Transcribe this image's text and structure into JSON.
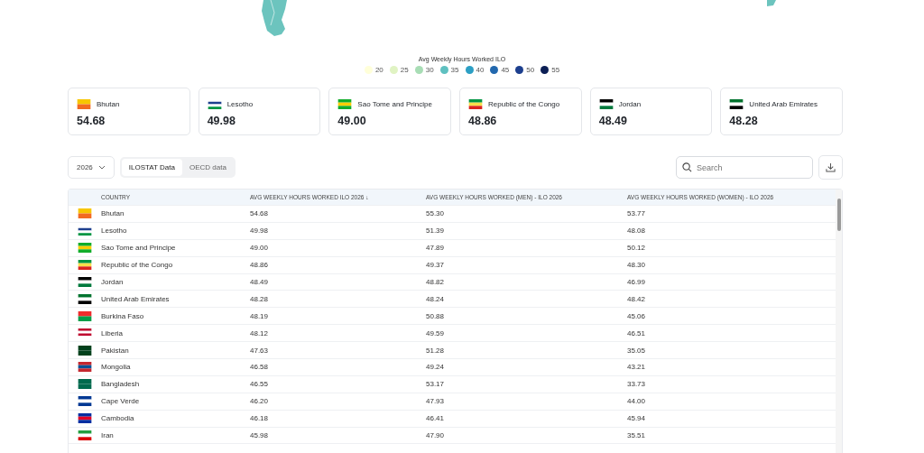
{
  "legend": {
    "title": "Avg Weekly Hours Worked ILO",
    "items": [
      {
        "label": "20",
        "color": "#ffffd9"
      },
      {
        "label": "25",
        "color": "#e0f3c3"
      },
      {
        "label": "30",
        "color": "#a8ddb5"
      },
      {
        "label": "35",
        "color": "#5fc0c0"
      },
      {
        "label": "40",
        "color": "#2c9fc4"
      },
      {
        "label": "45",
        "color": "#2268ae"
      },
      {
        "label": "50",
        "color": "#1d3f8e"
      },
      {
        "label": "55",
        "color": "#0c1f55"
      }
    ]
  },
  "cards": [
    {
      "country": "Bhutan",
      "value": "54.68"
    },
    {
      "country": "Lesotho",
      "value": "49.98"
    },
    {
      "country": "Sao Tome and Principe",
      "value": "49.00"
    },
    {
      "country": "Republic of the Congo",
      "value": "48.86"
    },
    {
      "country": "Jordan",
      "value": "48.49"
    },
    {
      "country": "United Arab Emirates",
      "value": "48.28"
    }
  ],
  "year_select": {
    "value": "2026"
  },
  "source_tabs": [
    {
      "label": "ILOSTAT Data",
      "selected": true
    },
    {
      "label": "OECD data",
      "selected": false
    }
  ],
  "search": {
    "placeholder": "Search"
  },
  "table": {
    "columns": [
      "COUNTRY",
      "AVG WEEKLY HOURS WORKED ILO 2026 ↓",
      "AVG WEEKLY HOURS WORKED (MEN) - ILO 2026",
      "AVG WEEKLY HOURS WORKED (WOMEN) - ILO 2026"
    ],
    "rows": [
      [
        "Bhutan",
        "54.68",
        "55.30",
        "53.77"
      ],
      [
        "Lesotho",
        "49.98",
        "51.39",
        "48.08"
      ],
      [
        "Sao Tome and Principe",
        "49.00",
        "47.89",
        "50.12"
      ],
      [
        "Republic of the Congo",
        "48.86",
        "49.37",
        "48.30"
      ],
      [
        "Jordan",
        "48.49",
        "48.82",
        "46.99"
      ],
      [
        "United Arab Emirates",
        "48.28",
        "48.24",
        "48.42"
      ],
      [
        "Burkina Faso",
        "48.19",
        "50.88",
        "45.06"
      ],
      [
        "Liberia",
        "48.12",
        "49.59",
        "46.51"
      ],
      [
        "Pakistan",
        "47.63",
        "51.28",
        "35.05"
      ],
      [
        "Mongolia",
        "46.58",
        "49.24",
        "43.21"
      ],
      [
        "Bangladesh",
        "46.55",
        "53.17",
        "33.73"
      ],
      [
        "Cape Verde",
        "46.20",
        "47.93",
        "44.00"
      ],
      [
        "Cambodia",
        "46.18",
        "46.41",
        "45.94"
      ],
      [
        "Iran",
        "45.98",
        "47.90",
        "35.51"
      ]
    ]
  }
}
